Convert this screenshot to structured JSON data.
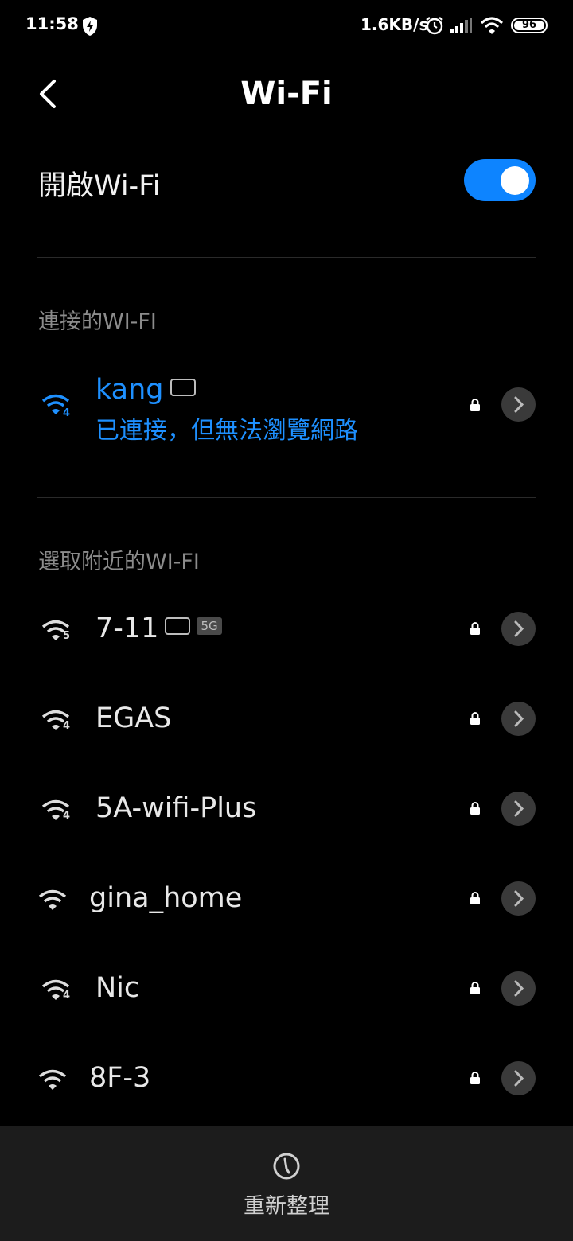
{
  "status_bar": {
    "time": "11:58",
    "net_speed": "1.6KB/s",
    "battery": "96"
  },
  "header": {
    "title": "Wi-Fi"
  },
  "wifi_toggle": {
    "label": "開啟Wi-Fi",
    "on": true
  },
  "connected_section": {
    "title": "連接的WI-FI",
    "network": {
      "ssid": "kang",
      "status": "已連接，但無法瀏覽網路",
      "signal_badge": "4"
    }
  },
  "nearby_section": {
    "title": "選取附近的WI-FI",
    "networks": [
      {
        "ssid": "7-11",
        "signal_badge": "5",
        "band": "5G"
      },
      {
        "ssid": "EGAS",
        "signal_badge": "4"
      },
      {
        "ssid": "5A-wifi-Plus",
        "signal_badge": "4"
      },
      {
        "ssid": "gina_home",
        "signal_badge": ""
      },
      {
        "ssid": "Nic",
        "signal_badge": "4"
      },
      {
        "ssid": "8F-3",
        "signal_badge": ""
      }
    ]
  },
  "bottom_bar": {
    "refresh_label": "重新整理"
  },
  "colors": {
    "accent": "#0d84ff",
    "connected_text": "#1e90ff",
    "background": "#000000"
  }
}
